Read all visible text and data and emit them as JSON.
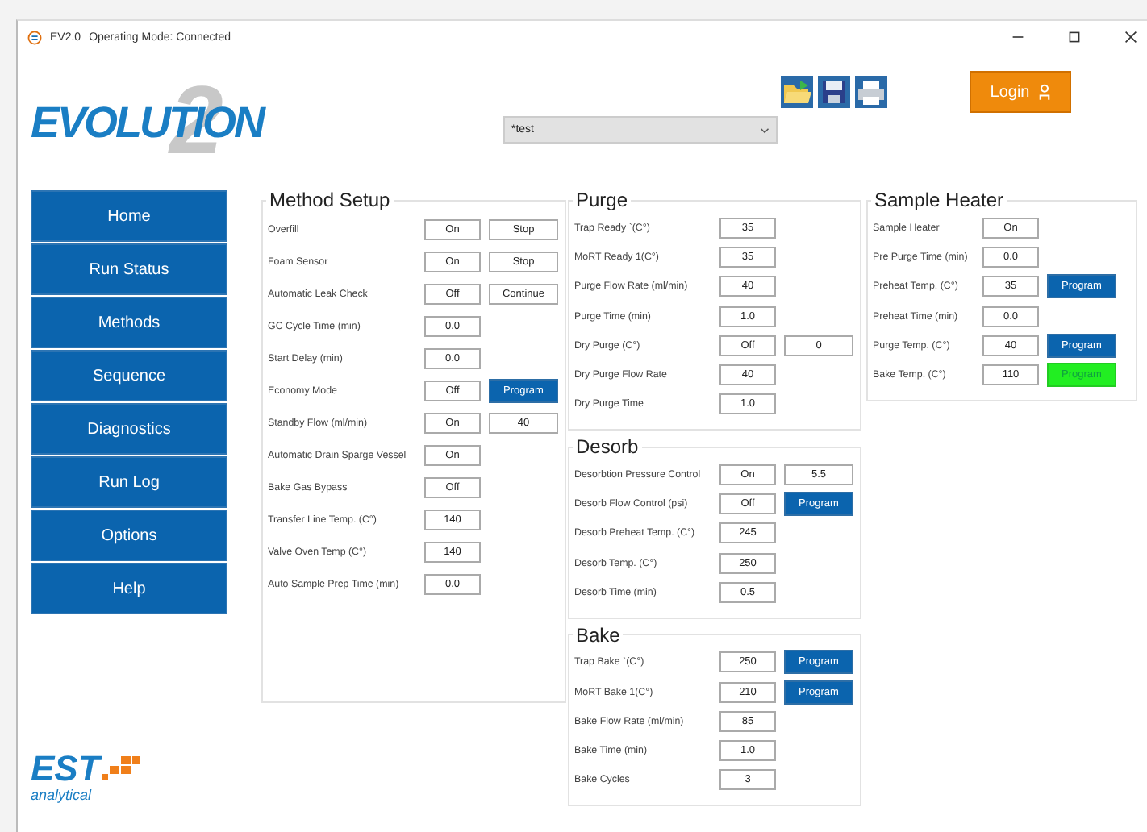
{
  "window": {
    "version": "EV2.0",
    "title": "Operating Mode: Connected"
  },
  "logo": {
    "text": "EVOLUTION",
    "number": "2"
  },
  "method_select": {
    "value": "*test"
  },
  "login_button": {
    "label": "Login"
  },
  "sidebar": {
    "items": [
      {
        "label": "Home"
      },
      {
        "label": "Run Status"
      },
      {
        "label": "Methods"
      },
      {
        "label": "Sequence"
      },
      {
        "label": "Diagnostics"
      },
      {
        "label": "Run Log"
      },
      {
        "label": "Options"
      },
      {
        "label": "Help"
      }
    ]
  },
  "brand": {
    "name": "EST",
    "subtitle": "analytical"
  },
  "panels": [
    {
      "title": "Method Setup",
      "rows": [
        {
          "label": "Overfill",
          "cells": [
            {
              "kind": "field",
              "text": "On"
            },
            {
              "kind": "field",
              "text": "Stop"
            }
          ]
        },
        {
          "label": "Foam Sensor",
          "cells": [
            {
              "kind": "field",
              "text": "On"
            },
            {
              "kind": "field",
              "text": "Stop"
            }
          ]
        },
        {
          "label": "Automatic Leak Check",
          "cells": [
            {
              "kind": "field",
              "text": "Off"
            },
            {
              "kind": "field",
              "text": "Continue"
            }
          ]
        },
        {
          "label": "GC Cycle Time (min)",
          "cells": [
            {
              "kind": "field",
              "text": "0.0"
            }
          ]
        },
        {
          "label": "Start Delay (min)",
          "cells": [
            {
              "kind": "field",
              "text": "0.0"
            }
          ]
        },
        {
          "label": "Economy Mode",
          "cells": [
            {
              "kind": "field",
              "text": "Off"
            },
            {
              "kind": "button",
              "text": "Program",
              "active": false
            }
          ]
        },
        {
          "label": "Standby Flow (ml/min)",
          "cells": [
            {
              "kind": "field",
              "text": "On"
            },
            {
              "kind": "field",
              "text": "40"
            }
          ]
        },
        {
          "label": "Automatic Drain Sparge Vessel",
          "cells": [
            {
              "kind": "field",
              "text": "On"
            }
          ]
        },
        {
          "label": "Bake Gas Bypass",
          "cells": [
            {
              "kind": "field",
              "text": "Off"
            }
          ]
        },
        {
          "label": "Transfer Line Temp.  (C°)",
          "cells": [
            {
              "kind": "field",
              "text": "140"
            }
          ]
        },
        {
          "label": "Valve Oven Temp (C°)",
          "cells": [
            {
              "kind": "field",
              "text": "140"
            }
          ]
        },
        {
          "label": "Auto Sample Prep Time (min)",
          "cells": [
            {
              "kind": "field",
              "text": "0.0"
            }
          ]
        }
      ]
    },
    {
      "title": "Purge",
      "rows": [
        {
          "label": "Trap Ready `(C°)",
          "cells": [
            {
              "kind": "field",
              "text": "35"
            }
          ]
        },
        {
          "label": "MoRT Ready 1(C°)",
          "cells": [
            {
              "kind": "field",
              "text": "35"
            }
          ]
        },
        {
          "label": "Purge Flow Rate (ml/min)",
          "cells": [
            {
              "kind": "field",
              "text": "40"
            }
          ]
        },
        {
          "label": "Purge Time (min)",
          "cells": [
            {
              "kind": "field",
              "text": "1.0"
            }
          ]
        },
        {
          "label": "Dry Purge (C°)",
          "cells": [
            {
              "kind": "field",
              "text": "Off"
            },
            {
              "kind": "field",
              "text": "0"
            }
          ]
        },
        {
          "label": "Dry Purge Flow Rate",
          "cells": [
            {
              "kind": "field",
              "text": "40"
            }
          ]
        },
        {
          "label": "Dry Purge Time",
          "cells": [
            {
              "kind": "field",
              "text": "1.0"
            }
          ]
        }
      ]
    },
    {
      "title": "Desorb",
      "rows": [
        {
          "label": "Desorbtion Pressure Control",
          "cells": [
            {
              "kind": "field",
              "text": "On"
            },
            {
              "kind": "field",
              "text": "5.5"
            }
          ]
        },
        {
          "label": "Desorb Flow Control (psi)",
          "cells": [
            {
              "kind": "field",
              "text": "Off"
            },
            {
              "kind": "button",
              "text": "Program",
              "active": false
            }
          ]
        },
        {
          "label": "Desorb Preheat Temp.  (C°)",
          "cells": [
            {
              "kind": "field",
              "text": "245"
            }
          ]
        },
        {
          "label": "Desorb Temp.  (C°)",
          "cells": [
            {
              "kind": "field",
              "text": "250"
            }
          ]
        },
        {
          "label": "Desorb Time (min)",
          "cells": [
            {
              "kind": "field",
              "text": "0.5"
            }
          ]
        }
      ]
    },
    {
      "title": "Bake",
      "rows": [
        {
          "label": "Trap Bake `(C°)",
          "cells": [
            {
              "kind": "field",
              "text": "250"
            },
            {
              "kind": "button",
              "text": "Program",
              "active": false
            }
          ]
        },
        {
          "label": "MoRT Bake 1(C°)",
          "cells": [
            {
              "kind": "field",
              "text": "210"
            },
            {
              "kind": "button",
              "text": "Program",
              "active": false
            }
          ]
        },
        {
          "label": "Bake Flow Rate (ml/min)",
          "cells": [
            {
              "kind": "field",
              "text": "85"
            }
          ]
        },
        {
          "label": "Bake Time (min)",
          "cells": [
            {
              "kind": "field",
              "text": "1.0"
            }
          ]
        },
        {
          "label": "Bake Cycles",
          "cells": [
            {
              "kind": "field",
              "text": "3"
            }
          ]
        }
      ]
    },
    {
      "title": "Sample Heater",
      "rows": [
        {
          "label": "Sample Heater",
          "cells": [
            {
              "kind": "field",
              "text": "On"
            }
          ]
        },
        {
          "label": "Pre Purge Time (min)",
          "cells": [
            {
              "kind": "field",
              "text": "0.0"
            }
          ]
        },
        {
          "label": "Preheat Temp.  (C°)",
          "cells": [
            {
              "kind": "field",
              "text": "35"
            },
            {
              "kind": "button",
              "text": "Program",
              "active": false
            }
          ]
        },
        {
          "label": "Preheat Time (min)",
          "cells": [
            {
              "kind": "field",
              "text": "0.0"
            }
          ]
        },
        {
          "label": "Purge Temp.  (C°)",
          "cells": [
            {
              "kind": "field",
              "text": "40"
            },
            {
              "kind": "button",
              "text": "Program",
              "active": false
            }
          ]
        },
        {
          "label": "Bake Temp.  (C°)",
          "cells": [
            {
              "kind": "field",
              "text": "110"
            },
            {
              "kind": "button",
              "text": "Program",
              "active": true
            }
          ]
        }
      ]
    }
  ]
}
